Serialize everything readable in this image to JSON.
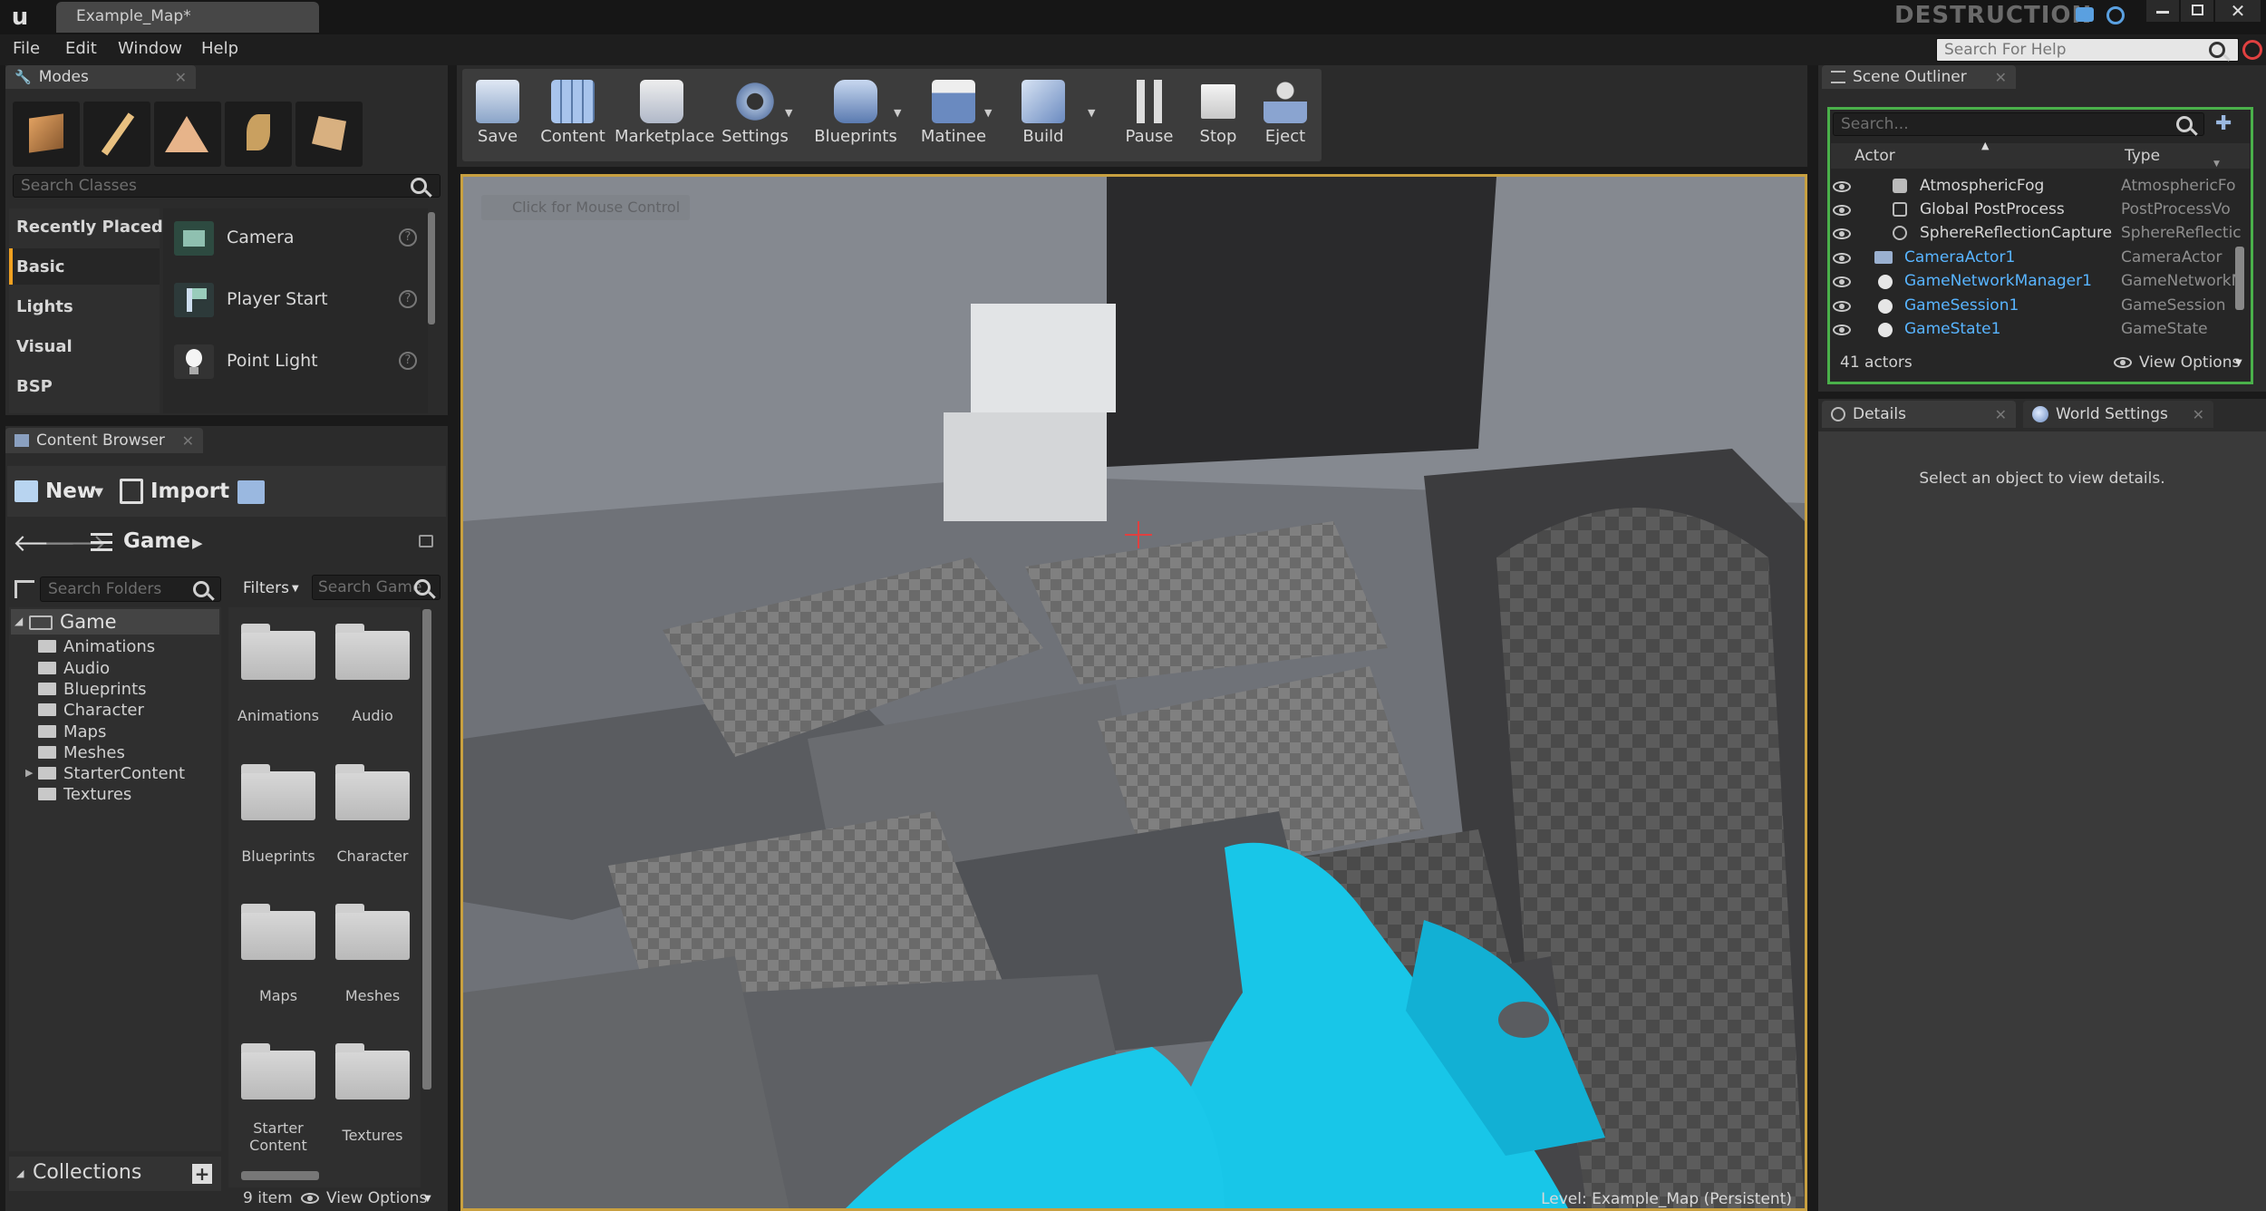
{
  "window": {
    "tab_title": "Example_Map*",
    "project_name": "DESTRUCTION",
    "help_search_placeholder": "Search For Help"
  },
  "menu": [
    "File",
    "Edit",
    "Window",
    "Help"
  ],
  "modes": {
    "tab": "Modes",
    "search_placeholder": "Search Classes",
    "categories": [
      "Recently Placed",
      "Basic",
      "Lights",
      "Visual",
      "BSP"
    ],
    "items": [
      "Camera",
      "Player Start",
      "Point Light"
    ]
  },
  "toolbar": [
    "Save",
    "Content",
    "Marketplace",
    "Settings",
    "Blueprints",
    "Matinee",
    "Build",
    "Pause",
    "Stop",
    "Eject"
  ],
  "viewport": {
    "hint": "Click for Mouse Control",
    "level_label": "Level:",
    "level_name": "Example_Map (Persistent)"
  },
  "content_browser": {
    "tab": "Content Browser",
    "new_label": "New",
    "import_label": "Import",
    "path": "Game",
    "folders_search_placeholder": "Search Folders",
    "filters_label": "Filters",
    "game_search_placeholder": "Search Game",
    "tree_root": "Game",
    "tree": [
      "Animations",
      "Audio",
      "Blueprints",
      "Character",
      "Maps",
      "Meshes",
      "StarterContent",
      "Textures"
    ],
    "tiles": [
      "Animations",
      "Audio",
      "Blueprints",
      "Character",
      "Maps",
      "Meshes",
      "Starter Content",
      "Textures"
    ],
    "items_count": "9 item",
    "view_options": "View Options",
    "collections": "Collections"
  },
  "outliner": {
    "tab": "Scene Outliner",
    "search_placeholder": "Search...",
    "col_actor": "Actor",
    "col_type": "Type",
    "rows": [
      {
        "name": "AtmosphericFog",
        "type": "AtmosphericFo",
        "link": false
      },
      {
        "name": "Global PostProcess",
        "type": "PostProcessVo",
        "link": false
      },
      {
        "name": "SphereReflectionCapture",
        "type": "SphereReflectic",
        "link": false
      },
      {
        "name": "CameraActor1",
        "type": "CameraActor",
        "link": true
      },
      {
        "name": "GameNetworkManager1",
        "type": "GameNetworkM",
        "link": true
      },
      {
        "name": "GameSession1",
        "type": "GameSession",
        "link": true
      },
      {
        "name": "GameState1",
        "type": "GameState",
        "link": true
      }
    ],
    "count": "41 actors",
    "view_options": "View Options"
  },
  "details": {
    "tab": "Details",
    "world_tab": "World Settings",
    "empty": "Select an object to view details."
  },
  "colors": {
    "accent_cyan": "#18c6e8",
    "link_blue": "#58b4ff",
    "bg_panel": "#3a3a3a"
  }
}
